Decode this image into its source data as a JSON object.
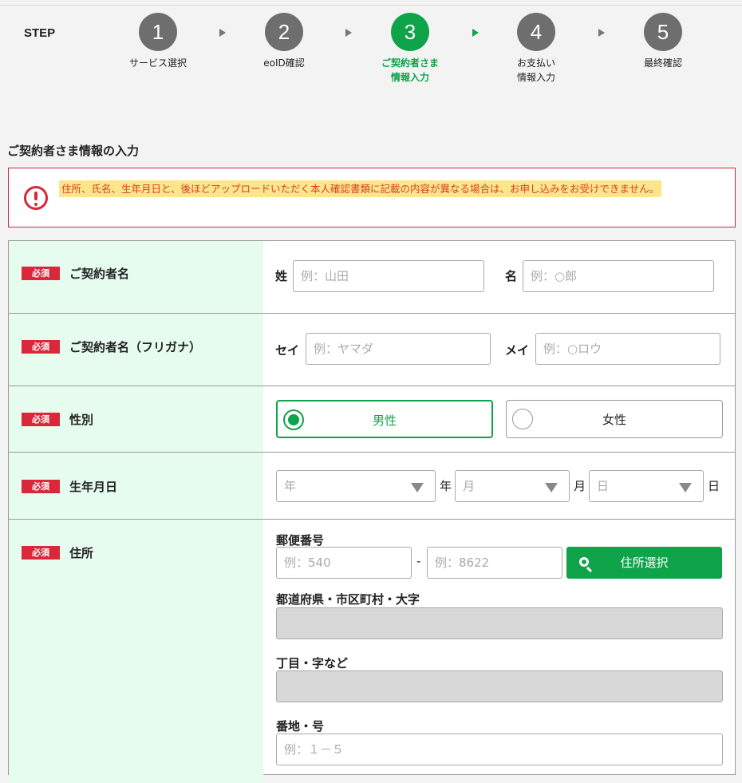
{
  "steps": {
    "label": "STEP",
    "items": [
      {
        "num": "1",
        "label": "サービス選択"
      },
      {
        "num": "2",
        "label": "eoID確認"
      },
      {
        "num": "3",
        "label": "ご契約者さま\n情報入力"
      },
      {
        "num": "4",
        "label": "お支払い\n情報入力"
      },
      {
        "num": "5",
        "label": "最終確認"
      }
    ],
    "active_index": 2
  },
  "section_title": "ご契約者さま情報の入力",
  "alert": {
    "text": "住所、氏名、生年月日と、後ほどアップロードいただく本人確認書類に記載の内容が異なる場合は、お申し込みをお受けできません。"
  },
  "form": {
    "required_badge": "必須",
    "name": {
      "label": "ご契約者名",
      "last_label": "姓",
      "last_placeholder": "例：山田",
      "first_label": "名",
      "first_placeholder": "例：○郎"
    },
    "kana": {
      "label": "ご契約者名（フリガナ）",
      "last_label": "セイ",
      "last_placeholder": "例：ヤマダ",
      "first_label": "メイ",
      "first_placeholder": "例：○ロウ"
    },
    "gender": {
      "label": "性別",
      "options": [
        "男性",
        "女性"
      ],
      "selected": "男性"
    },
    "birth": {
      "label": "生年月日",
      "year_placeholder": "年",
      "year_unit": "年",
      "month_placeholder": "月",
      "month_unit": "月",
      "day_placeholder": "日",
      "day_unit": "日"
    },
    "address": {
      "label": "住所",
      "postal_label": "郵便番号",
      "postal1_placeholder": "例：540",
      "postal_sep": "-",
      "postal2_placeholder": "例：8622",
      "search_button": "住所選択",
      "pref_label": "都道府県・市区町村・大字",
      "chome_label": "丁目・字など",
      "banchi_label": "番地・号",
      "banchi_placeholder": "例：１－５"
    }
  },
  "colors": {
    "accent": "#0fa34a",
    "required": "#d8283a",
    "label_bg": "#e6fcee"
  }
}
